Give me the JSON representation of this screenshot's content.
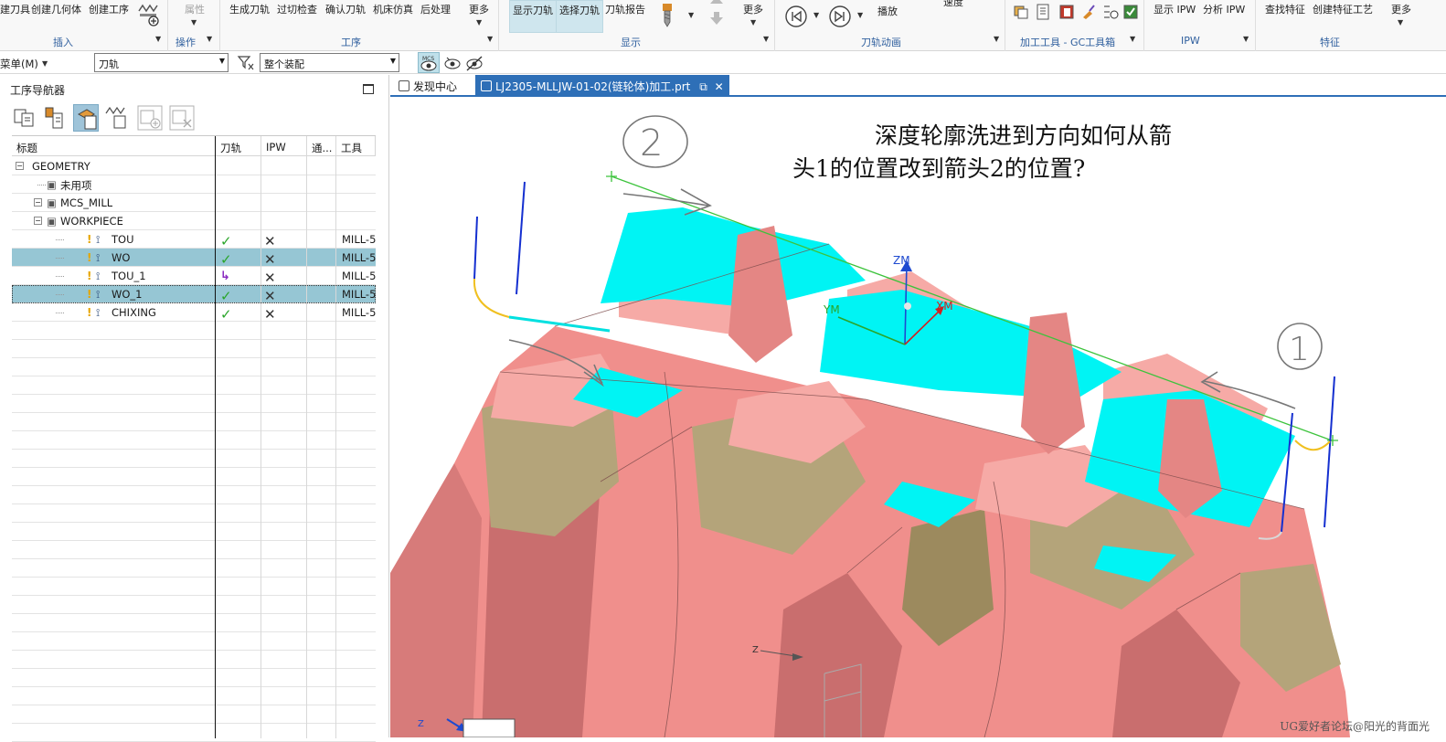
{
  "ribbon": {
    "insert": {
      "buttons": [
        "建刀具",
        "创建几何体",
        "创建工序"
      ],
      "group_label": "插入"
    },
    "operation": {
      "property_label": "属性",
      "group_label": "操作"
    },
    "procedure": {
      "buttons": [
        "生成刀轨",
        "过切检查",
        "确认刀轨",
        "机床仿真",
        "后处理",
        "更多"
      ],
      "group_label": "工序"
    },
    "display": {
      "buttons": [
        "显示刀轨",
        "选择刀轨",
        "刀轨报告",
        "更多"
      ],
      "group_label": "显示"
    },
    "animation": {
      "play_label": "播放",
      "speed_label": "速度",
      "group_label": "刀轨动画"
    },
    "gc": {
      "group_label": "加工工具 - GC工具箱"
    },
    "ipw": {
      "buttons": [
        "显示 IPW",
        "分析 IPW"
      ],
      "group_label": "IPW"
    },
    "feature": {
      "buttons": [
        "查找特征",
        "创建特征工艺",
        "更多"
      ],
      "group_label": "特征"
    }
  },
  "selbar": {
    "menu_label": "菜单(M)",
    "filter_value": "刀轨",
    "scope_value": "整个装配"
  },
  "navigator": {
    "title": "工序导航器",
    "columns": [
      "标题",
      "刀轨",
      "IPW",
      "通...",
      "工具"
    ],
    "rows": [
      {
        "name": "GEOMETRY",
        "level": 0,
        "toggle": "−",
        "icon": "geometry-icon"
      },
      {
        "name": "未用项",
        "level": 1,
        "icon": "unused-folder-icon"
      },
      {
        "name": "MCS_MILL",
        "level": 1,
        "toggle": "−",
        "icon": "mcs-icon"
      },
      {
        "name": "WORKPIECE",
        "level": 2,
        "toggle": "−",
        "icon": "workpiece-icon"
      },
      {
        "name": "TOU",
        "level": 3,
        "path": "✓",
        "ipw": "✕",
        "tool": "MILL-5",
        "state": ""
      },
      {
        "name": "WO",
        "level": 3,
        "path": "✓",
        "ipw": "✕",
        "tool": "MILL-5",
        "state": "sel"
      },
      {
        "name": "TOU_1",
        "level": 3,
        "path": "↳",
        "ipw": "✕",
        "tool": "MILL-5",
        "state": ""
      },
      {
        "name": "WO_1",
        "level": 3,
        "path": "✓",
        "ipw": "✕",
        "tool": "MILL-5",
        "state": "sel2"
      },
      {
        "name": "CHIXING",
        "level": 3,
        "path": "✓",
        "ipw": "✕",
        "tool": "MILL-5",
        "state": ""
      }
    ]
  },
  "tabs": [
    {
      "label": "发现中心",
      "active": false
    },
    {
      "label": "LJ2305-MLLJW-01-02(链轮体)加工.prt",
      "active": true
    }
  ],
  "canvas": {
    "question_line1": "深度轮廓洗进到方向如何从箭",
    "question_line2": "头1的位置改到箭头2的位置?",
    "marker_1": "1",
    "marker_2": "2",
    "axis_zm": "ZM",
    "axis_ym": "YM",
    "axis_xm": "XM",
    "axis_z": "Z",
    "watermark": "UG爱好者论坛@阳光的背面光"
  },
  "colors": {
    "accent": "#2e6fb7",
    "part": "#f08f8c",
    "part_dark": "#c06a6a",
    "olive": "#b4a47a",
    "cyan": "#00f4f4",
    "selected_row": "#96c6d4"
  }
}
